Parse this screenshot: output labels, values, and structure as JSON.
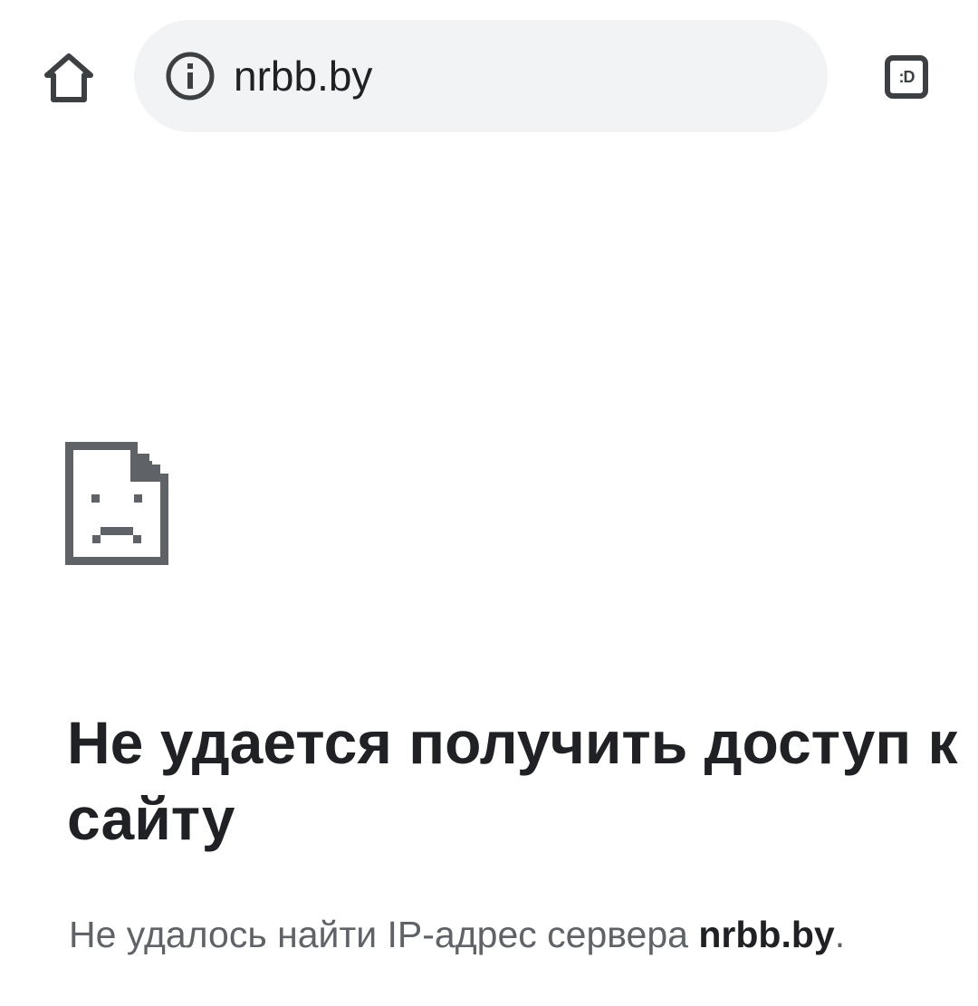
{
  "browser": {
    "url": "nrbb.by",
    "tab_switcher_label": ":D",
    "icons": {
      "home": "home-icon",
      "site_info": "info-icon",
      "tabs": "tab-switcher-icon"
    }
  },
  "error_page": {
    "icon": "sad-page-icon",
    "title": "Не удается получить доступ к сайту",
    "description_prefix": "Не удалось найти IP-адрес сервера ",
    "description_host": "nrbb.by",
    "description_suffix": "."
  },
  "colors": {
    "omnibox_bg": "#f1f3f4",
    "icon": "#3c4043",
    "title_text": "#202124",
    "body_text": "#5f6368"
  }
}
